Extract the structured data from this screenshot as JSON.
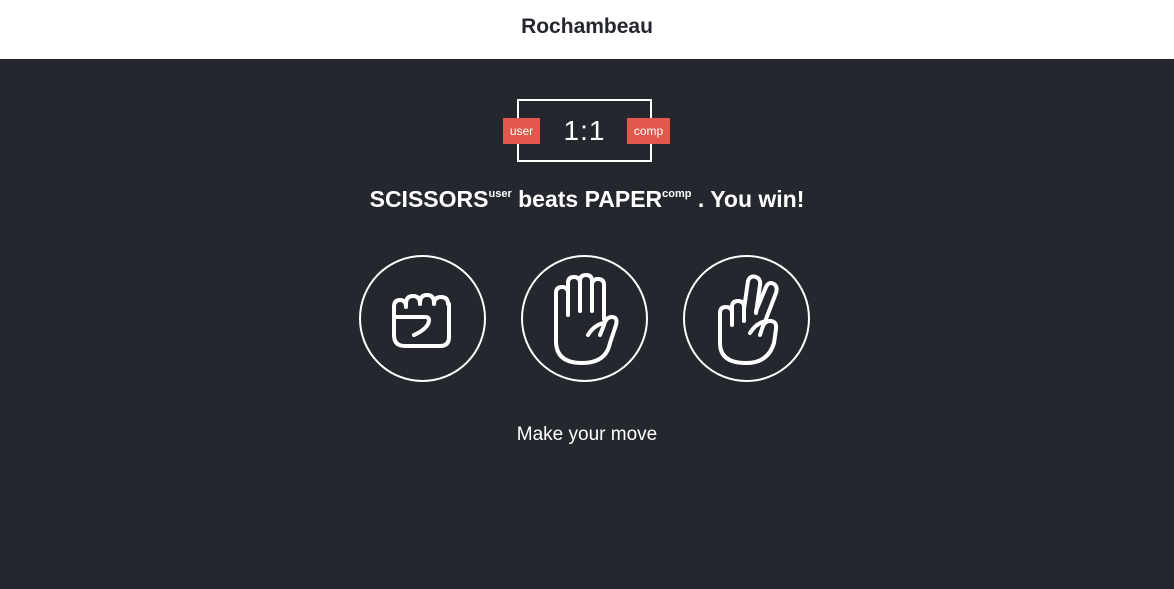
{
  "app": {
    "title": "Rochambeau"
  },
  "scoreboard": {
    "user_label": "user",
    "comp_label": "comp",
    "score": "1:1"
  },
  "result": {
    "user_move": "SCISSORS",
    "user_tag": "user",
    "verb": "beats",
    "comp_move": "PAPER",
    "comp_tag": "comp",
    "outcome": ". You win!"
  },
  "choices": [
    {
      "name": "rock",
      "icon": "rock-fist-icon"
    },
    {
      "name": "paper",
      "icon": "paper-hand-icon"
    },
    {
      "name": "scissors",
      "icon": "scissors-hand-icon"
    }
  ],
  "prompt": "Make your move",
  "colors": {
    "background": "#24272e",
    "header": "#ffffff",
    "accent": "#e2584d",
    "foreground": "#ffffff"
  }
}
